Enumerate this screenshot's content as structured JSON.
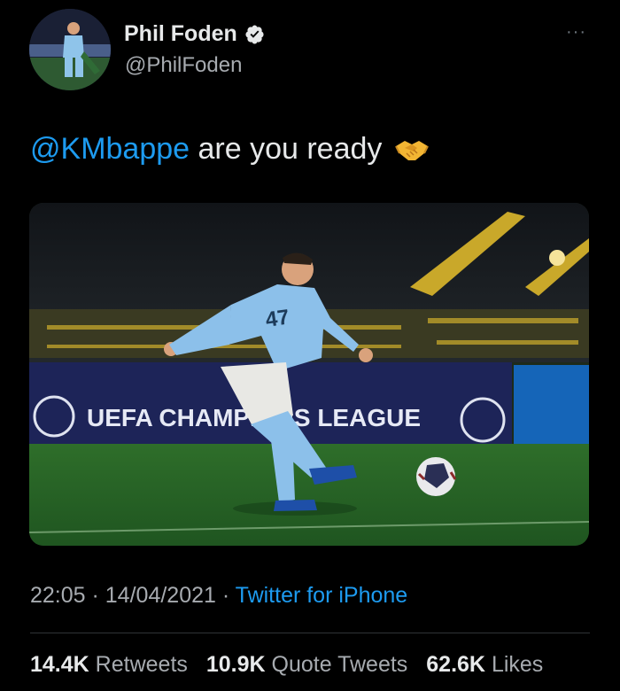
{
  "user": {
    "display_name": "Phil Foden",
    "handle": "@PhilFoden",
    "verified": true
  },
  "more_menu": {
    "label": "···"
  },
  "tweet": {
    "mention": "@KMbappe",
    "text": " are you ready",
    "emoji": "handshake-emoji"
  },
  "media": {
    "banner_text": "UEFA CHAMPIONS LEAGUE",
    "shirt_number": "47"
  },
  "meta": {
    "time": "22:05",
    "separator1": " · ",
    "date": "14/04/2021",
    "separator2": " · ",
    "source": "Twitter for iPhone"
  },
  "stats": {
    "retweets_count": "14.4K",
    "retweets_label": "Retweets",
    "quote_count": "10.9K",
    "quote_label": "Quote Tweets",
    "likes_count": "62.6K",
    "likes_label": "Likes"
  },
  "colors": {
    "background": "#000000",
    "link": "#1d9bf0",
    "primary_text": "#e7e9ea",
    "secondary_text": "#a7abb0"
  }
}
